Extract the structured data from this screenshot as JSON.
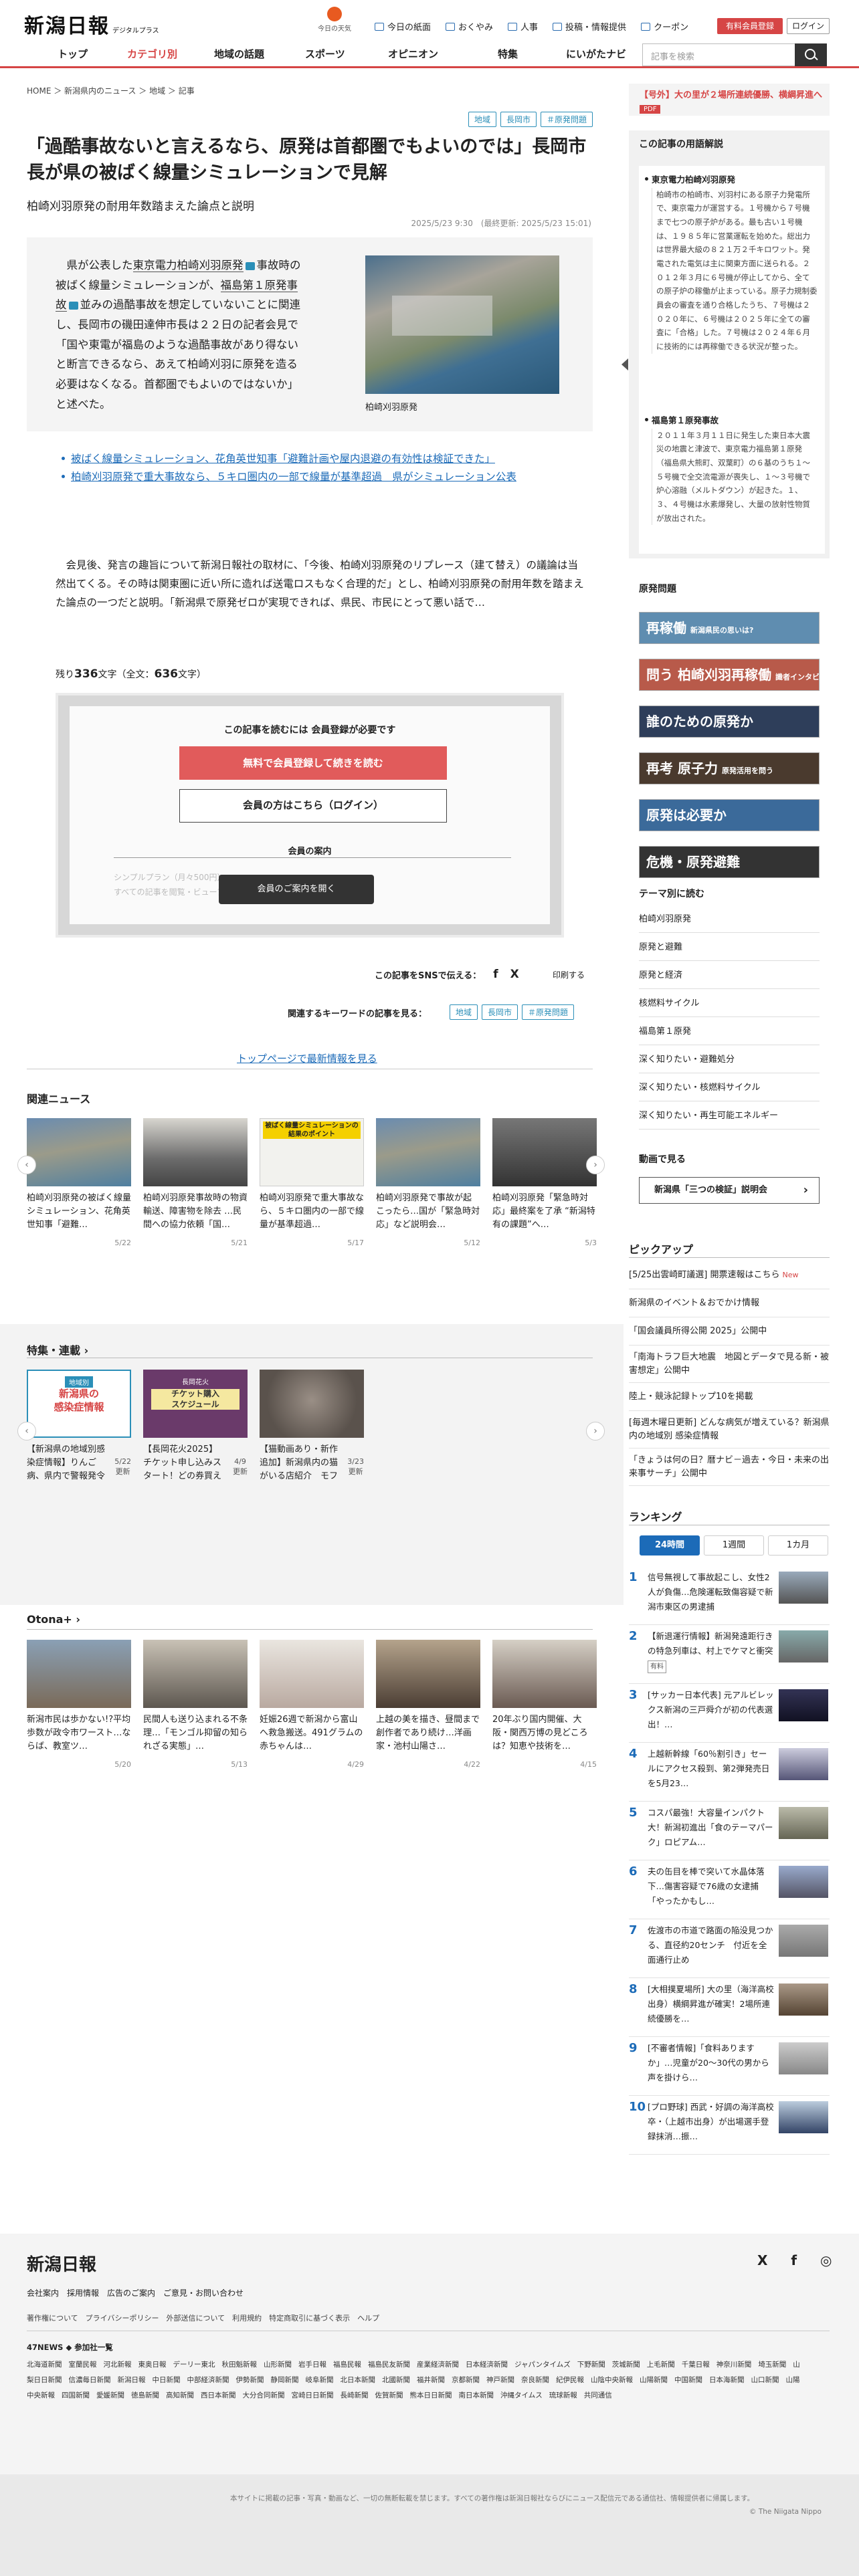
{
  "header": {
    "logo": "新潟日報",
    "logo_sub": "デジタルプラス",
    "weather_label": "今日の天気",
    "links": [
      "今日の紙面",
      "おくやみ",
      "人事",
      "投稿・情報提供",
      "クーポン"
    ],
    "register": "有料会員登録",
    "login": "ログイン",
    "nav": [
      "トップ",
      "カテゴリ別",
      "地域の話題",
      "スポーツ",
      "オピニオン",
      "特集",
      "にいがたナビ"
    ],
    "search_placeholder": "記事を検索"
  },
  "breadcrumb": "HOME ＞ 新潟県内のニュース ＞ 地域 ＞ 記事",
  "article": {
    "tags": [
      "地域",
      "長岡市",
      "＃原発問題"
    ],
    "title": "「過酷事故ないと言えるなら、原発は首都圏でもよいのでは」長岡市長が県の被ばく線量シミュレーションで見解",
    "subtitle": "柏崎刈羽原発の耐用年数踏まえた論点と説明",
    "dateline": "2025/5/23 9:30　(最終更新: 2025/5/23 15:01)",
    "lead_1": "　県が公表した",
    "lead_link1": "東京電力柏崎刈羽原発",
    "lead_2": "事故時の被ばく線量シミュレーションが、",
    "lead_link2": "福島第１原発事故",
    "lead_3": "並みの過酷事故を想定していないことに関連し、長岡市の磯田達伸市長は２２日の記者会見で「国や東電が福島のような過酷事故があり得ないと断言できるなら、あえて柏崎刈羽に原発を造る必要はなくなる。首都圏でもよいのではないか」と述べた。",
    "photo_caption": "柏崎刈羽原発",
    "related": [
      "被ばく線量シミュレーション、花角英世知事「避難計画や屋内退避の有効性は検証できた」",
      "柏崎刈羽原発で重大事故なら、５キロ圏内の一部で線量が基準超過　県がシミュレーション公表"
    ],
    "body2": "　会見後、発言の趣旨について新潟日報社の取材に、「今後、柏崎刈羽原発のリプレース（建て替え）の議論は当然出てくる。その時は関東圏に近い所に造れば送電ロスもなく合理的だ」とし、柏崎刈羽原発の耐用年数を踏まえた論点の一つだと説明。「新潟県で原発ゼロが実現できれば、県民、市民にとって悪い話で…",
    "remain_pre": "残り",
    "remain": "336",
    "remain_mid": "文字（全文：",
    "total": "636",
    "remain_post": "文字）"
  },
  "paywall": {
    "title": "この記事を読むには 会員登録が必要です",
    "free_btn": "無料で会員登録して続きを読む",
    "member_btn": "会員の方はこちら（ログイン）",
    "guide": "会員の案内",
    "faded": "シンプルプラン（月々500円）…\nすべての記事を閲覧・ビューア…",
    "guide_btn": "会員のご案内を開く"
  },
  "share": {
    "label": "この記事をSNSで伝える：",
    "fb": "f",
    "x": "X",
    "print": "印刷する"
  },
  "keywords": {
    "label": "関連するキーワードの記事を見る：",
    "tags": [
      "地域",
      "長岡市",
      "＃原発問題"
    ]
  },
  "top_link": "トップページで最新情報を見る",
  "related_news": {
    "heading": "関連ニュース",
    "items": [
      {
        "cap": "柏崎刈羽原発の被ばく線量シミュレーション、花角英世知事「避難…",
        "date": "5/22"
      },
      {
        "cap": "柏崎刈羽原発事故時の物資輸送、障害物を除去 …民間への協力依頼「国…",
        "date": "5/21"
      },
      {
        "cap": "柏崎刈羽原発で重大事故なら、５キロ圏内の一部で線量が基準超過…",
        "date": "5/17"
      },
      {
        "cap": "柏崎刈羽原発で事故が起こったら…国が「緊急時対応」など説明会…",
        "date": "5/12"
      },
      {
        "cap": "柏崎刈羽原発「緊急時対応」最終案を了承 “新潟特有の課題”へ…",
        "date": "5/3"
      }
    ],
    "overlay_text": "被ばく線量シミュレーションの結果のポイント"
  },
  "tokushu": {
    "heading": "特集・連載",
    "items": [
      {
        "cap": "【新潟県の地域別感染症情報】りんご病、県内で警報発令中…村上…",
        "date": "5/22\n更新",
        "badge": "地域別",
        "badge_title": "新潟県の\n感染症情報"
      },
      {
        "cap": "【長岡花火2025】チケット申し込みスタート！どの券買えば良…",
        "date": "4/9\n更新",
        "badge": "長岡花火",
        "badge_title": "チケット購入\nスケジュール"
      },
      {
        "cap": "【猫動画あり・新作追加】新潟県内の猫がいる店紹介　モフモフに…",
        "date": "3/23\n更新",
        "badge": "",
        "badge_title": ""
      }
    ]
  },
  "otona": {
    "heading": "Otona+",
    "items": [
      {
        "cap": "新潟市民は歩かない!?平均歩数が政令市ワースト…ならば、教室ツ…",
        "date": "5/20"
      },
      {
        "cap": "民間人も送り込まれる不条理…「モンゴル抑留の知られざる実態」…",
        "date": "5/13"
      },
      {
        "cap": "妊娠26週で新潟から富山へ救急搬送。491グラムの赤ちゃんは…",
        "date": "4/29"
      },
      {
        "cap": "上越の美を描き、昼間まで創作者であり続け…洋画家・池村山陽さ…",
        "date": "4/22"
      },
      {
        "cap": "20年ぶり国内開催、大阪・関西万博の見どころは？知恵や技術を…",
        "date": "4/15"
      }
    ]
  },
  "sidebar": {
    "marquee": "【号外】大の里が２場所連続優勝、横綱昇進へ",
    "pdf": "PDF",
    "glossary_heading": "この記事の用語解説",
    "glossary": [
      {
        "term": "東京電力柏崎刈羽原発",
        "desc": "柏崎市の柏崎市、刈羽村にある原子力発電所で、東京電力が運営する。１号機から７号機まで七つの原子炉がある。最も古い１号機は、１９８５年に営業運転を始めた。総出力は世界最大級の８２１万２千キロワット。発電された電気は主に関東方面に送られる。２０１２年３月に６号機が停止してから、全ての原子炉の稼働が止まっている。原子力規制委員会の審査を通り合格したうち、７号機は２０２０年に、６号機は２０２５年に全ての審査に「合格」した。７号機は２０２４年６月に技術的には再稼働できる状況が整った。"
      },
      {
        "term": "福島第１原発事故",
        "desc": "２０１１年３月１１日に発生した東日本大震災の地震と津波で、東京電力福島第１原発（福島県大熊町、双葉町）の６基のうち１～５号機で全交流電源が喪失し、１～３号機で炉心溶融（メルトダウン）が起きた。１、３、４号機は水素爆発し、大量の放射性物質が放出された。"
      }
    ],
    "genpatsu_heading": "原発問題",
    "banners": [
      {
        "t": "再稼働",
        "s": "新潟県民の思いは?"
      },
      {
        "t": "問う 柏崎刈羽再稼働",
        "s": "識者インタビュー"
      },
      {
        "t": "誰のための原発か",
        "s": ""
      },
      {
        "t": "再考 原子力",
        "s": "原発活用を問う"
      },
      {
        "t": "原発は必要か",
        "s": ""
      },
      {
        "t": "危機・原発避難",
        "s": ""
      }
    ],
    "theme_heading": "テーマ別に読む",
    "themes": [
      "柏崎刈羽原発",
      "原発と避難",
      "原発と経済",
      "核燃料サイクル",
      "福島第１原発",
      "深く知りたい・避難処分",
      "深く知りたい・核燃料サイクル",
      "深く知りたい・再生可能エネルギー"
    ],
    "video_heading": "動画で見る",
    "video_btn": "新潟県「三つの検証」説明会",
    "pickup_heading": "ピックアップ",
    "pickups": [
      {
        "t": "[5/25出雲崎町議選] 開票速報はこちら",
        "new": "New"
      },
      {
        "t": "新潟県のイベント＆おでかけ情報",
        "new": ""
      },
      {
        "t": "「国会議員所得公開 2025」公開中",
        "new": ""
      },
      {
        "t": "「南海トラフ巨大地震　地図とデータで見る新・被害想定」公開中",
        "new": ""
      },
      {
        "t": "陸上・競泳記録トップ10を掲載",
        "new": ""
      },
      {
        "t": "[毎週木曜日更新] どんな病気が増えている？新潟県内の地域別 感染症情報",
        "new": ""
      },
      {
        "t": "「きょうは何の日？暦ナビ－過去・今日・未来の出来事サーチ」公開中",
        "new": ""
      }
    ],
    "ranking_heading": "ランキング",
    "ranking_tabs": [
      "24時間",
      "1週間",
      "1カ月"
    ],
    "ranking": [
      {
        "n": "1",
        "t": "信号無視して事故起こし、女性2人が負傷…危険運転致傷容疑で新潟市東区の男逮捕"
      },
      {
        "n": "2",
        "t": "【新退運行情報】新潟発遠距行きの特急列車は、村上でケマと衝突"
      },
      {
        "n": "3",
        "t": "[サッカー日本代表] 元アルビレックス新潟の三戸舜介が初の代表選出！…"
      },
      {
        "n": "4",
        "t": "上越新幹線「60％割引き」セールにアクセス殺到、第2弾発売日を5月23…"
      },
      {
        "n": "5",
        "t": "コスパ最強！大容量インパクト大！新潟初進出「食のテーマパーク」ロピアム…"
      },
      {
        "n": "6",
        "t": "夫の缶目を棒で突いて水晶体落下…傷害容疑で76歳の女逮捕「やったかもし…"
      },
      {
        "n": "7",
        "t": "佐渡市の市道で路面の陥没見つかる、直径約20センチ　付近を全面通行止め"
      },
      {
        "n": "8",
        "t": "[大相撲夏場所] 大の里（海洋高校出身）横綱昇進が確実！2場所連続優勝を…"
      },
      {
        "n": "9",
        "t": "[不審者情報]「食料ありますか」…児童が20～30代の男から声を掛けら…"
      },
      {
        "n": "10",
        "t": "[プロ野球] 西武・好調の海洋高校卒・（上越市出身）が出場選手登録抹消…振…"
      }
    ],
    "member_badge": "有料"
  },
  "footer": {
    "logo": "新潟日報",
    "social": "X f ◎",
    "links1": "会社案内　採用情報　広告のご案内　ご意見・お問い合わせ",
    "links2": "著作権について　プライバシーポリシー　外部送信について　利用規約　特定商取引に基づく表示　ヘルプ",
    "news47": "47NEWS ◆ 参加社一覧",
    "papers": [
      "北海道新聞",
      "室蘭民報",
      "河北新報",
      "東奥日報",
      "デーリー東北",
      "秋田魁新報",
      "山形新聞",
      "岩手日報",
      "福島民報",
      "福島民友新聞",
      "産業経済新聞",
      "日本経済新聞",
      "ジャパンタイムズ",
      "下野新聞",
      "茨城新聞",
      "上毛新聞",
      "千葉日報",
      "神奈川新聞",
      "埼玉新聞",
      "山梨日日新聞",
      "信濃毎日新聞",
      "新潟日報",
      "中日新聞",
      "中部経済新聞",
      "伊勢新聞",
      "静岡新聞",
      "岐阜新聞",
      "北日本新聞",
      "北國新聞",
      "福井新聞",
      "京都新聞",
      "神戸新聞",
      "奈良新聞",
      "紀伊民報",
      "山陰中央新報",
      "山陽新聞",
      "中国新聞",
      "日本海新聞",
      "山口新聞",
      "山陽中央新報",
      "四国新聞",
      "愛媛新聞",
      "徳島新聞",
      "高知新聞",
      "西日本新聞",
      "大分合同新聞",
      "宮崎日日新聞",
      "長崎新聞",
      "佐賀新聞",
      "熊本日日新聞",
      "南日本新聞",
      "沖縄タイムス",
      "琉球新報",
      "共同通信"
    ],
    "notice": "本サイトに掲載の記事・写真・動画など、一切の無断転載を禁じます。すべての著作権は新潟日報社ならびにニュース配信元である通信社、情報提供者に帰属します。",
    "copy": "© The Niigata Nippo"
  }
}
